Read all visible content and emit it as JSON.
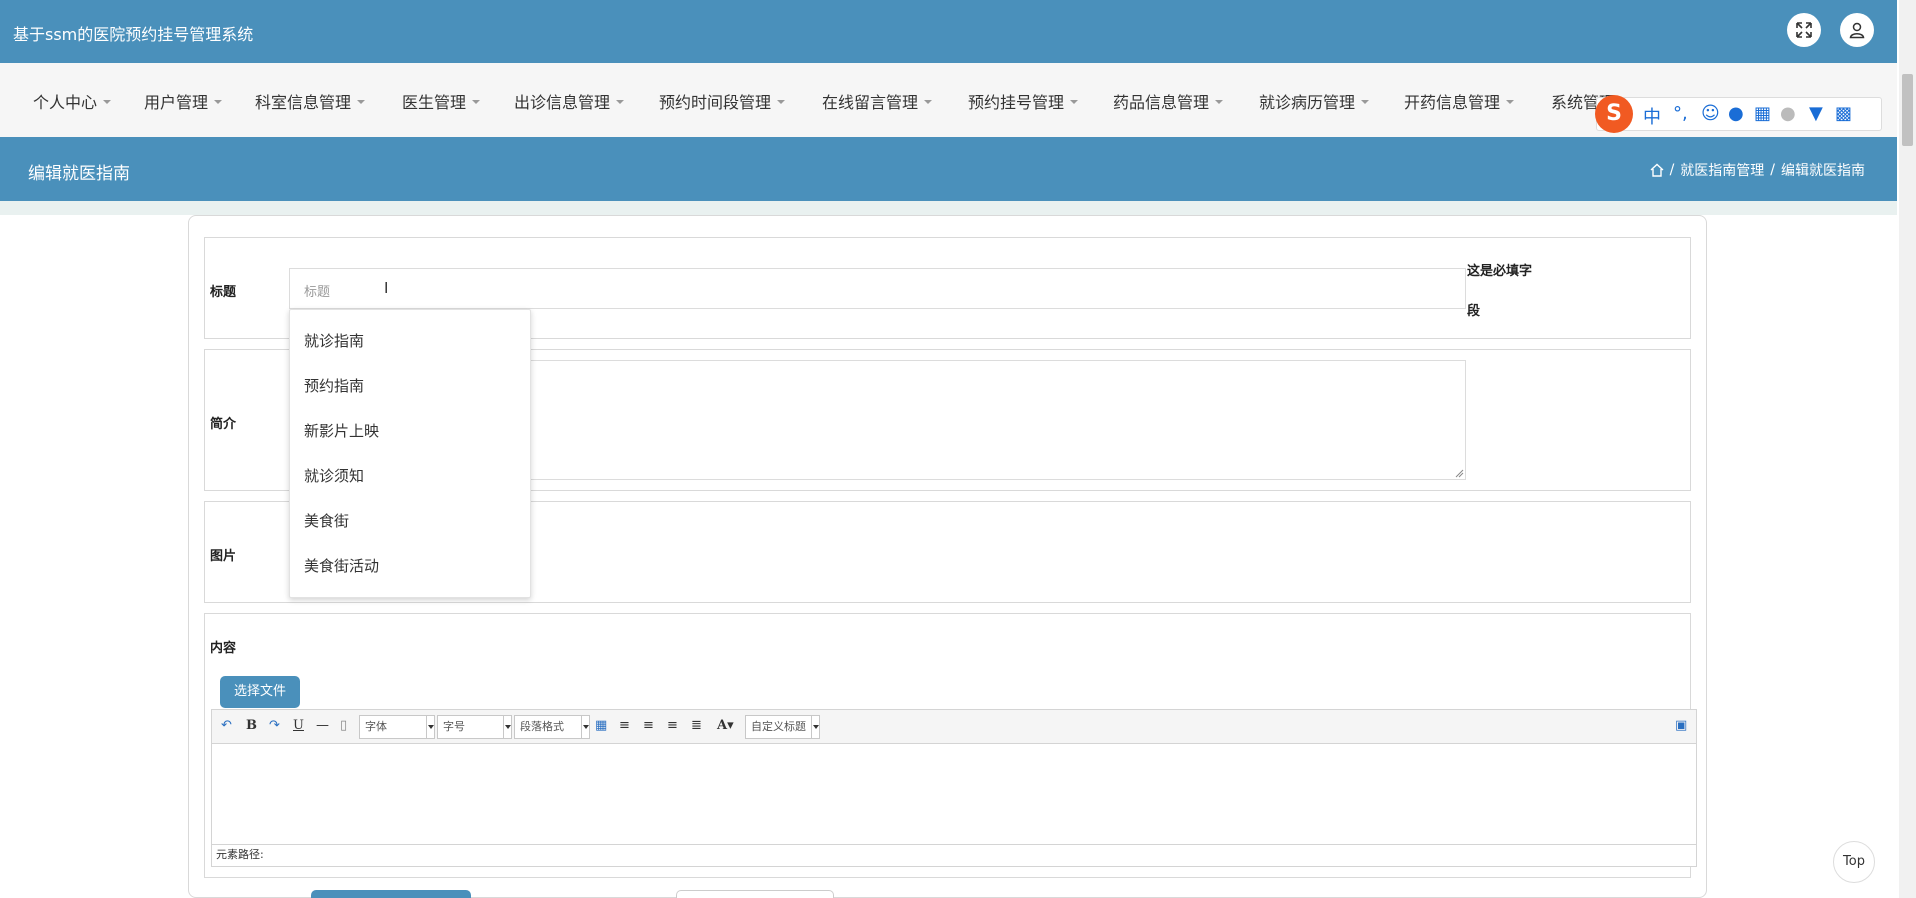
{
  "app": {
    "title": "基于ssm的医院预约挂号管理系统"
  },
  "nav": {
    "items": [
      {
        "label": "个人中心"
      },
      {
        "label": "用户管理"
      },
      {
        "label": "科室信息管理"
      },
      {
        "label": "医生管理"
      },
      {
        "label": "出诊信息管理"
      },
      {
        "label": "预约时间段管理"
      },
      {
        "label": "在线留言管理"
      },
      {
        "label": "预约挂号管理"
      },
      {
        "label": "药品信息管理"
      },
      {
        "label": "就诊病历管理"
      },
      {
        "label": "开药信息管理"
      },
      {
        "label": "系统管理"
      }
    ]
  },
  "ime": {
    "logo": "S",
    "lang": "中",
    "punct": "°,"
  },
  "page": {
    "title": "编辑就医指南",
    "breadcrumb": [
      "就医指南管理",
      "编辑就医指南"
    ],
    "breadcrumb_sep": "/"
  },
  "form": {
    "title_label": "标题",
    "title_placeholder": "标题",
    "required_hint_line1": "这是必填字",
    "required_hint_line2": "段",
    "intro_label": "简介",
    "image_label": "图片",
    "content_label": "内容",
    "file_button": "选择文件"
  },
  "autocomplete": {
    "items": [
      "就诊指南",
      "预约指南",
      "新影片上映",
      "就诊须知",
      "美食街",
      "美食街活动"
    ]
  },
  "editor": {
    "font_select": "字体",
    "size_select": "字号",
    "para_select": "段落格式",
    "custom_select": "自定义标题",
    "path_label": "元素路径:"
  },
  "top_button": "Top",
  "colors": {
    "primary": "#4a90bb",
    "band": "#e9f1f0"
  }
}
